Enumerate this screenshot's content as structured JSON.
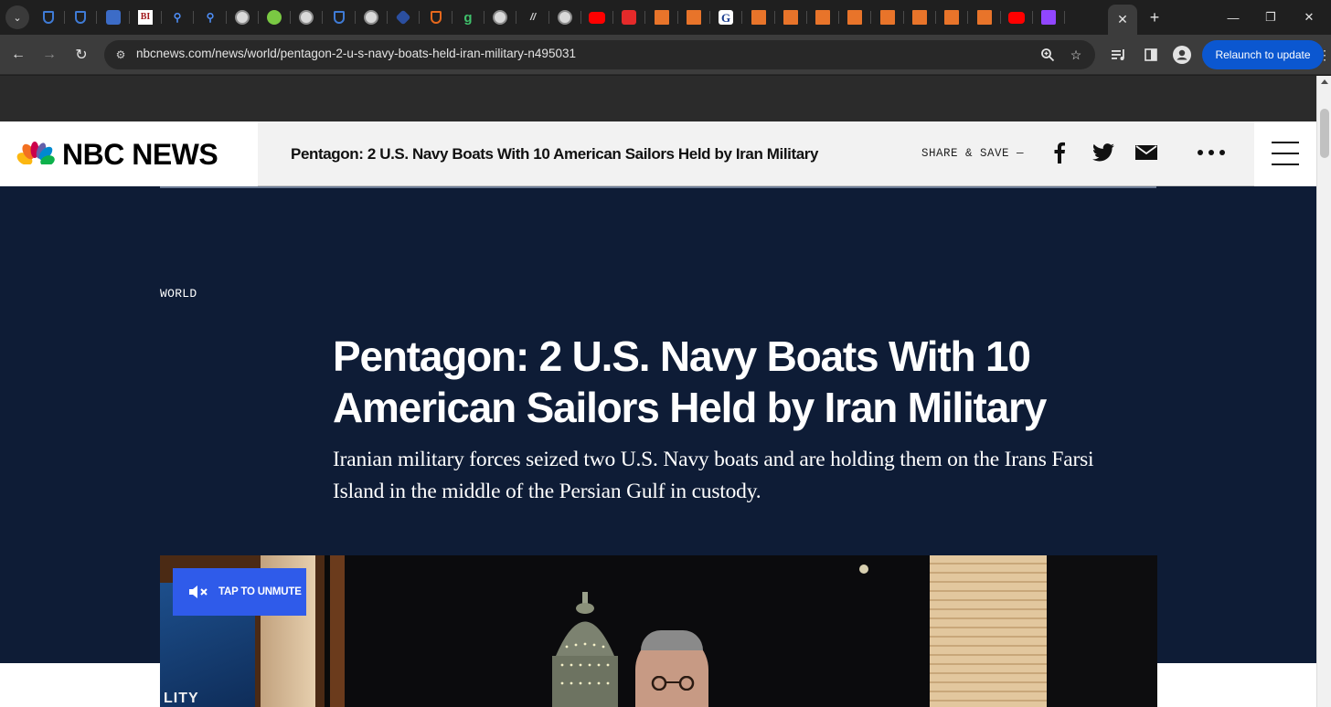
{
  "browser": {
    "tab_menu_icon": "chevron-down-icon",
    "tabs": [
      {
        "icon": "shield-icon",
        "style": "shield"
      },
      {
        "icon": "shield-icon",
        "style": "shield"
      },
      {
        "icon": "arrow-icon",
        "style": "arrow"
      },
      {
        "icon": "business-insider-icon",
        "style": "bi",
        "glyph": "BI"
      },
      {
        "icon": "search-icon",
        "style": "search",
        "glyph": "⚲"
      },
      {
        "icon": "search-icon",
        "style": "search",
        "glyph": "⚲"
      },
      {
        "icon": "globe-icon",
        "style": "globe"
      },
      {
        "icon": "play-icon",
        "style": "play"
      },
      {
        "icon": "globe-icon",
        "style": "globe"
      },
      {
        "icon": "shield-icon",
        "style": "shield"
      },
      {
        "icon": "globe-icon",
        "style": "globe"
      },
      {
        "icon": "hexagon-icon",
        "style": "hex"
      },
      {
        "icon": "ublock-icon",
        "style": "ublock"
      },
      {
        "icon": "g-green-icon",
        "style": "green",
        "glyph": "g"
      },
      {
        "icon": "globe-icon",
        "style": "globe"
      },
      {
        "icon": "slash-icon",
        "style": "slash",
        "glyph": "//"
      },
      {
        "icon": "globe-icon",
        "style": "globe"
      },
      {
        "icon": "youtube-icon",
        "style": "yt"
      },
      {
        "icon": "red-app-icon",
        "style": "red"
      },
      {
        "icon": "bookmark-icon",
        "style": "bookmark"
      },
      {
        "icon": "bookmark-icon",
        "style": "bookmark"
      },
      {
        "icon": "google-news-icon",
        "style": "g",
        "glyph": "G"
      },
      {
        "icon": "bookmark-icon",
        "style": "bookmark"
      },
      {
        "icon": "bookmark-icon",
        "style": "bookmark"
      },
      {
        "icon": "bookmark-icon",
        "style": "bookmark"
      },
      {
        "icon": "bookmark-icon",
        "style": "bookmark"
      },
      {
        "icon": "bookmark-icon",
        "style": "bookmark"
      },
      {
        "icon": "bookmark-icon",
        "style": "bookmark"
      },
      {
        "icon": "bookmark-icon",
        "style": "bookmark"
      },
      {
        "icon": "bookmark-icon",
        "style": "bookmark"
      },
      {
        "icon": "youtube-icon",
        "style": "yt"
      },
      {
        "icon": "twitch-icon",
        "style": "twitch"
      }
    ],
    "active_tab_icon": "close-icon",
    "url": "nbcnews.com/news/world/pentagon-2-u-s-navy-boats-held-iran-military-n495031",
    "relaunch_label": "Relaunch to update",
    "accent": "#0b57d0"
  },
  "site": {
    "logo_text": "NBC NEWS",
    "sticky_title": "Pentagon: 2 U.S. Navy Boats With 10 American Sailors Held by Iran Military",
    "share_label": "SHARE & SAVE —",
    "share_icons": [
      "facebook-icon",
      "twitter-icon",
      "email-icon",
      "more-icon"
    ],
    "menu_icon": "hamburger-menu-icon"
  },
  "article": {
    "section": "WORLD",
    "headline": "Pentagon: 2 U.S. Navy Boats With 10 American Sailors Held by Iran Military",
    "dek": "Iranian military forces seized two U.S. Navy boats and are holding them on the Irans Farsi Island in the middle of the Persian Gulf in custody.",
    "background": "#0e1c36"
  },
  "video": {
    "unmute_label": "TAP TO UNMUTE",
    "unmute_color": "#2f5bea",
    "screen_text": "LITY"
  }
}
